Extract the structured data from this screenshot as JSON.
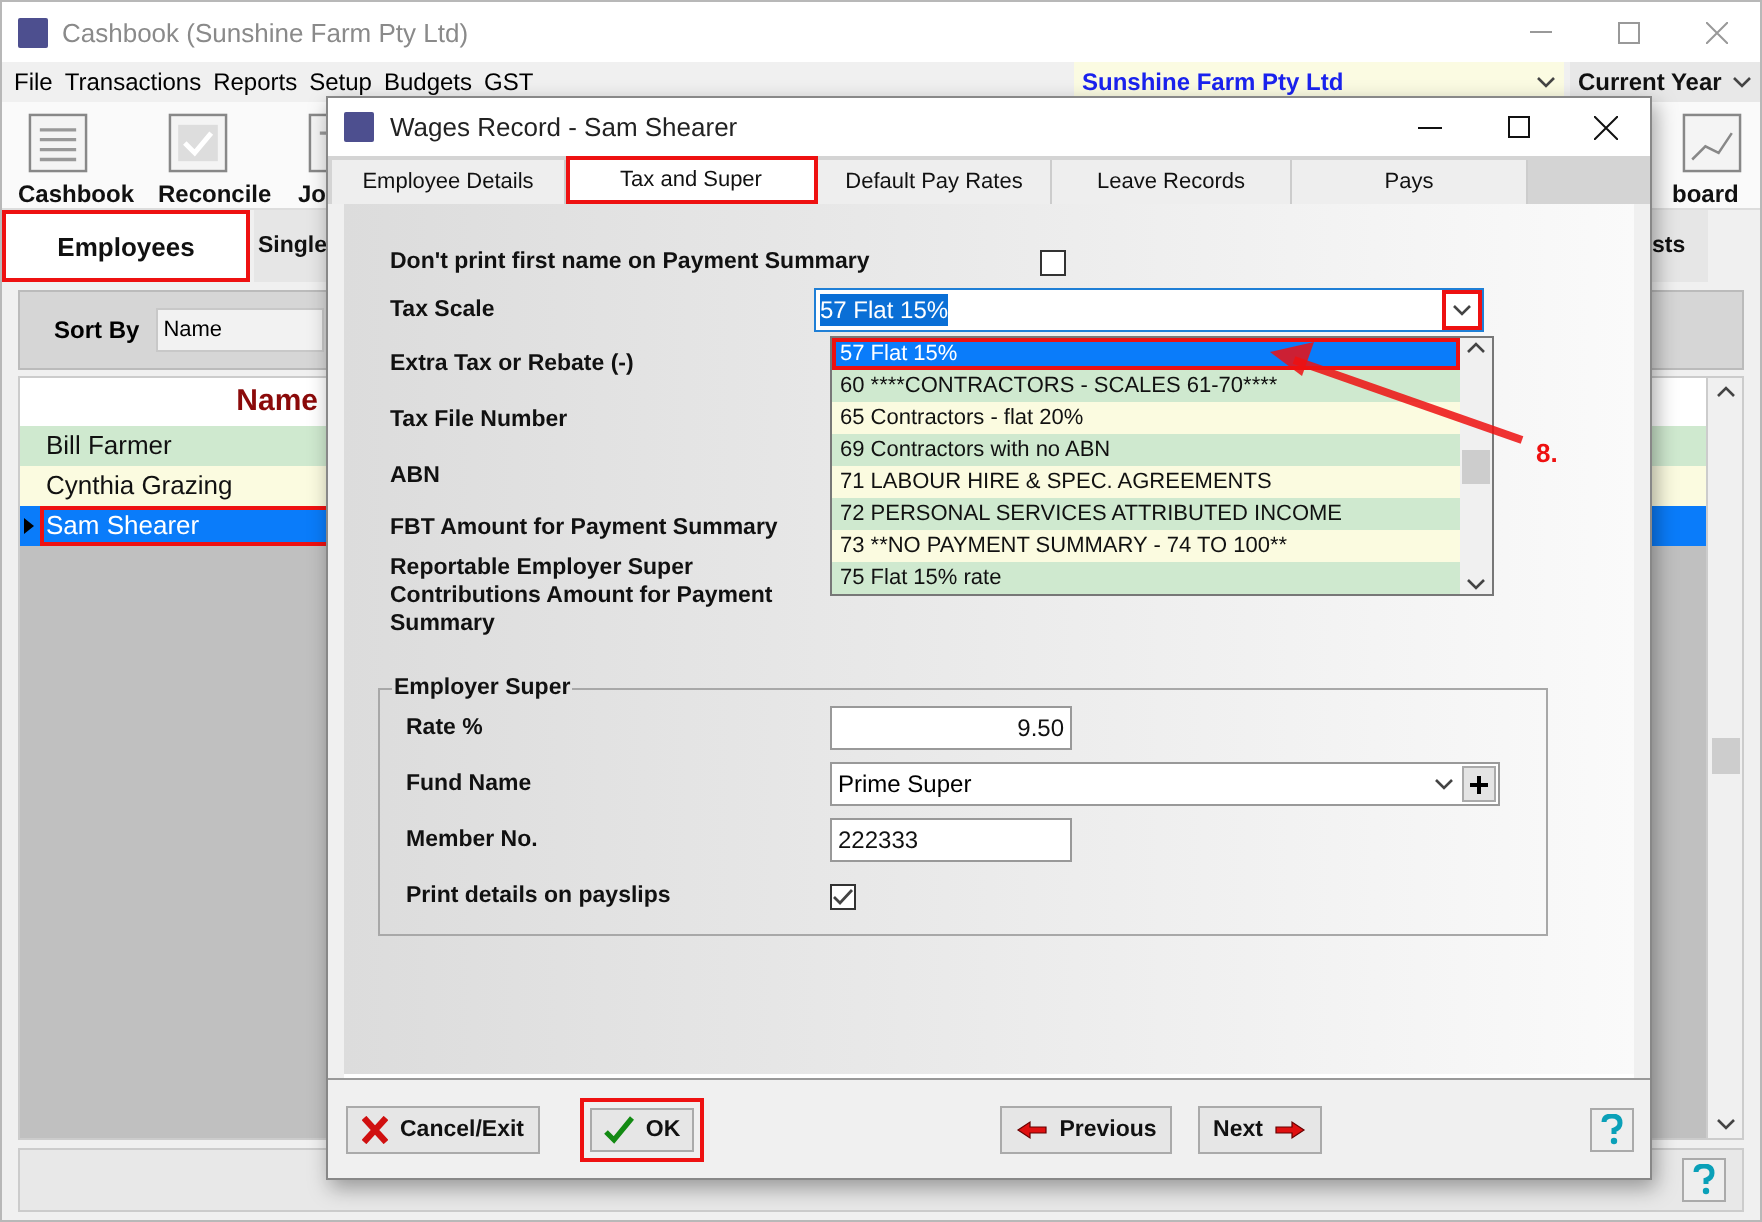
{
  "main_window": {
    "title": "Cashbook (Sunshine Farm Pty Ltd)",
    "menu": [
      "File",
      "Transactions",
      "Reports",
      "Setup",
      "Budgets",
      "GST"
    ],
    "company": "Sunshine Farm Pty Ltd",
    "period": "Current Year",
    "toolbar": [
      {
        "label": "Cashbook",
        "kind": "list"
      },
      {
        "label": "Reconcile",
        "kind": "check"
      },
      {
        "label": "Jo",
        "kind": "doc"
      }
    ],
    "toolbar_right": {
      "label": "board",
      "kind": "chart"
    },
    "tabs": [
      {
        "label": "Employees",
        "selected": true,
        "highlighted": true
      },
      {
        "label": "Single",
        "selected": false,
        "highlighted": false
      }
    ],
    "tab_right": {
      "label": "sts",
      "selected": false
    },
    "sort_by": {
      "label": "Sort By",
      "value": "Name"
    },
    "grid": {
      "column": "Name",
      "rows": [
        {
          "name": "Bill Farmer",
          "selected": false,
          "highlighted": false
        },
        {
          "name": "Cynthia Grazing",
          "selected": false,
          "highlighted": false
        },
        {
          "name": "Sam Shearer",
          "selected": true,
          "highlighted": true
        }
      ]
    }
  },
  "dialog": {
    "title": "Wages Record - Sam Shearer",
    "tabs": [
      {
        "label": "Employee Details",
        "selected": false,
        "highlighted": false
      },
      {
        "label": "Tax and Super",
        "selected": true,
        "highlighted": true
      },
      {
        "label": "Default Pay Rates",
        "selected": false,
        "highlighted": false
      },
      {
        "label": "Leave Records",
        "selected": false,
        "highlighted": false
      },
      {
        "label": "Pays",
        "selected": false,
        "highlighted": false
      }
    ],
    "no_first_name": {
      "label": "Don't print first name on Payment Summary",
      "checked": false
    },
    "tax_scale": {
      "label": "Tax Scale",
      "value": "57 Flat 15%",
      "button_highlighted": true,
      "options": [
        {
          "label": "57 Flat 15%",
          "selected": true,
          "highlighted": true
        },
        {
          "label": "60 ****CONTRACTORS - SCALES 61-70****",
          "selected": false,
          "highlighted": false
        },
        {
          "label": "65 Contractors - flat 20%",
          "selected": false,
          "highlighted": false
        },
        {
          "label": "69 Contractors with no ABN",
          "selected": false,
          "highlighted": false
        },
        {
          "label": "71 LABOUR HIRE & SPEC. AGREEMENTS",
          "selected": false,
          "highlighted": false
        },
        {
          "label": "72 PERSONAL SERVICES ATTRIBUTED INCOME",
          "selected": false,
          "highlighted": false
        },
        {
          "label": "73 **NO PAYMENT SUMMARY - 74 TO 100**",
          "selected": false,
          "highlighted": false
        },
        {
          "label": "75 Flat 15% rate",
          "selected": false,
          "highlighted": false
        }
      ]
    },
    "labels": [
      "Extra Tax or Rebate (-)",
      "Tax File Number",
      "ABN",
      "FBT Amount for Payment Summary",
      "Reportable Employer Super Contributions Amount for Payment Summary"
    ],
    "employer_super": {
      "title": "Employer Super",
      "rate": {
        "label": "Rate %",
        "value": "9.50"
      },
      "fund": {
        "label": "Fund Name",
        "value": "Prime Super"
      },
      "member": {
        "label": "Member No.",
        "value": "222333"
      },
      "payslips": {
        "label": "Print details on payslips",
        "checked": true
      }
    },
    "buttons": [
      {
        "label": "Cancel/Exit",
        "kind": "cancel",
        "highlighted": false
      },
      {
        "label": "OK",
        "kind": "ok",
        "highlighted": true
      },
      {
        "label": "Previous",
        "kind": "previous",
        "highlighted": false
      },
      {
        "label": "Next",
        "kind": "next",
        "highlighted": false
      }
    ]
  },
  "annotation": {
    "label": "8."
  }
}
